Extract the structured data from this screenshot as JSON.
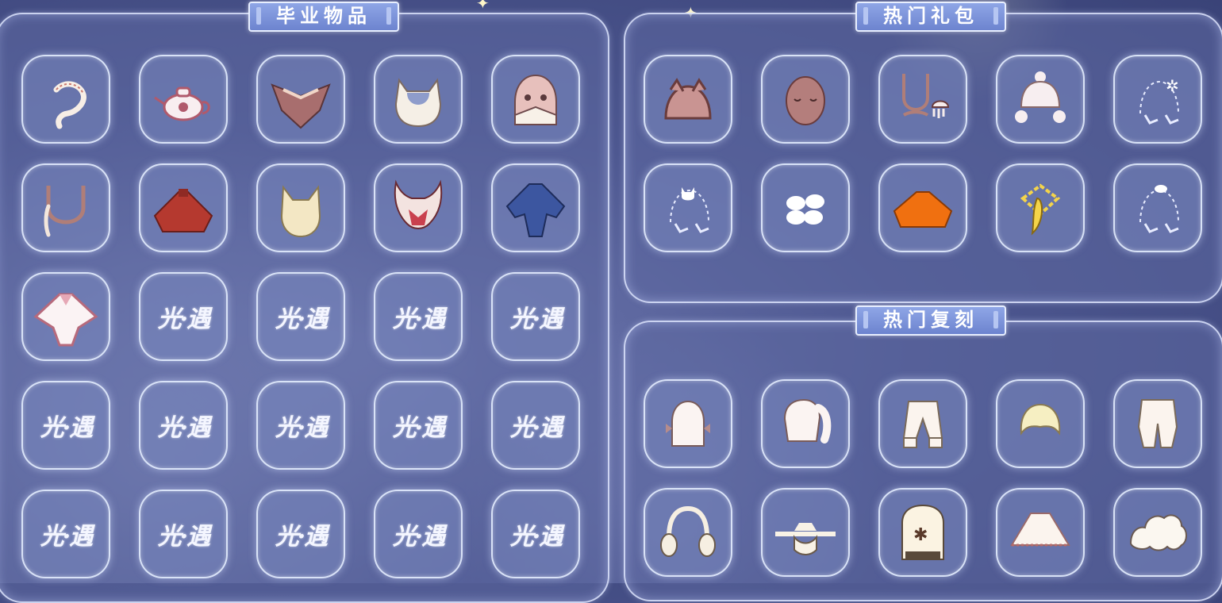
{
  "sections": {
    "graduation": {
      "title": "毕业物品"
    },
    "hot_packs": {
      "title": "热门礼包"
    },
    "hot_retro": {
      "title": "热门复刻"
    }
  },
  "placeholder_logo_text": "光·遇",
  "graduation_items": [
    "shrimp-hairpin-icon",
    "teapot-icon",
    "wing-cape-icon",
    "cat-ear-hair-icon",
    "hood-mask-icon",
    "necklace-icon",
    "red-cape-icon",
    "horned-hair-icon",
    "antler-mask-icon",
    "blue-cape-icon",
    "pink-cape-icon",
    "logo",
    "logo",
    "logo",
    "logo",
    "logo",
    "logo",
    "logo",
    "logo",
    "logo",
    "logo",
    "logo",
    "logo",
    "logo",
    "logo"
  ],
  "hot_pack_items": [
    "pig-hat-icon",
    "sleepy-mask-icon",
    "jellyfish-necklace-icon",
    "pompom-beanie-icon",
    "music-note-emote-icon",
    "cat-music-emote-icon",
    "clover-hair-icon",
    "orange-cape-icon",
    "banana-prop-icon",
    "bird-music-emote-icon"
  ],
  "hot_retro_items": [
    "twin-tail-hair-icon",
    "ponytail-hair-icon",
    "white-pants-icon",
    "short-hair-icon",
    "baggy-pants-icon",
    "earmuffs-icon",
    "straw-hat-icon",
    "piano-icon",
    "white-cape-icon",
    "cloud-hair-icon"
  ],
  "colors": {
    "panel_border": "#e1e8ff",
    "tab_bg": "#7b92d8",
    "red_cape": "#b5392f",
    "blue_cape": "#3c56a0",
    "orange_cape": "#f07010",
    "banana": "#f4d44a"
  }
}
